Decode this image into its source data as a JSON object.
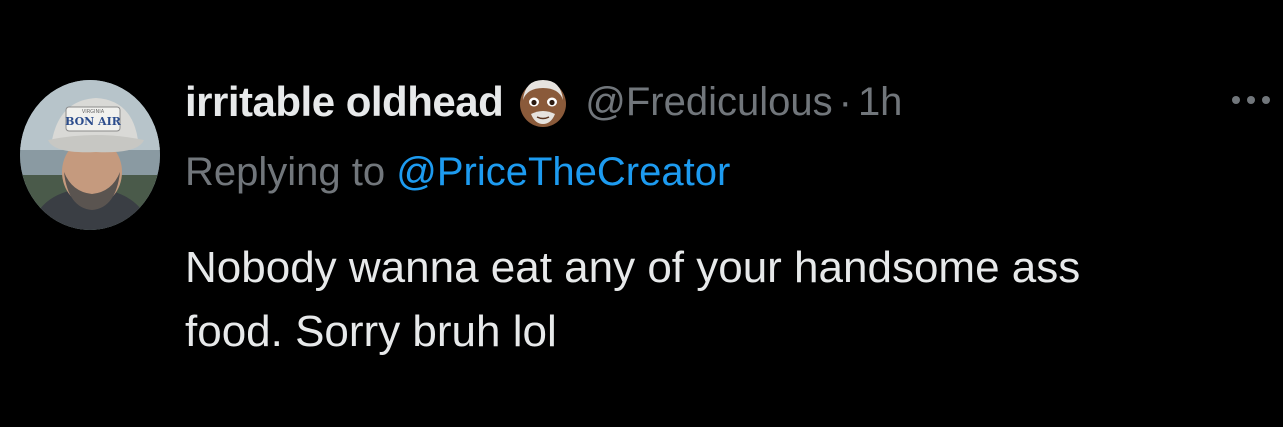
{
  "tweet": {
    "display_name": "irritable oldhead",
    "handle": "@Frediculous",
    "separator": "·",
    "time": "1h",
    "reply_prefix": "Replying to",
    "reply_mention": "@PriceTheCreator",
    "text_line1": "Nobody wanna eat any of your handsome ass",
    "text_line2": "food. Sorry bruh lol",
    "avatar_cap_text": "BON AIR",
    "avatar_cap_small": "VIRGINIA",
    "name_emoji": "older-man-medium-dark-skin-emoji",
    "more_icon": "more-horizontal-icon"
  },
  "colors": {
    "background": "#000000",
    "primary_text": "#e7e9ea",
    "secondary_text": "#71767b",
    "link": "#1d9bf0"
  }
}
